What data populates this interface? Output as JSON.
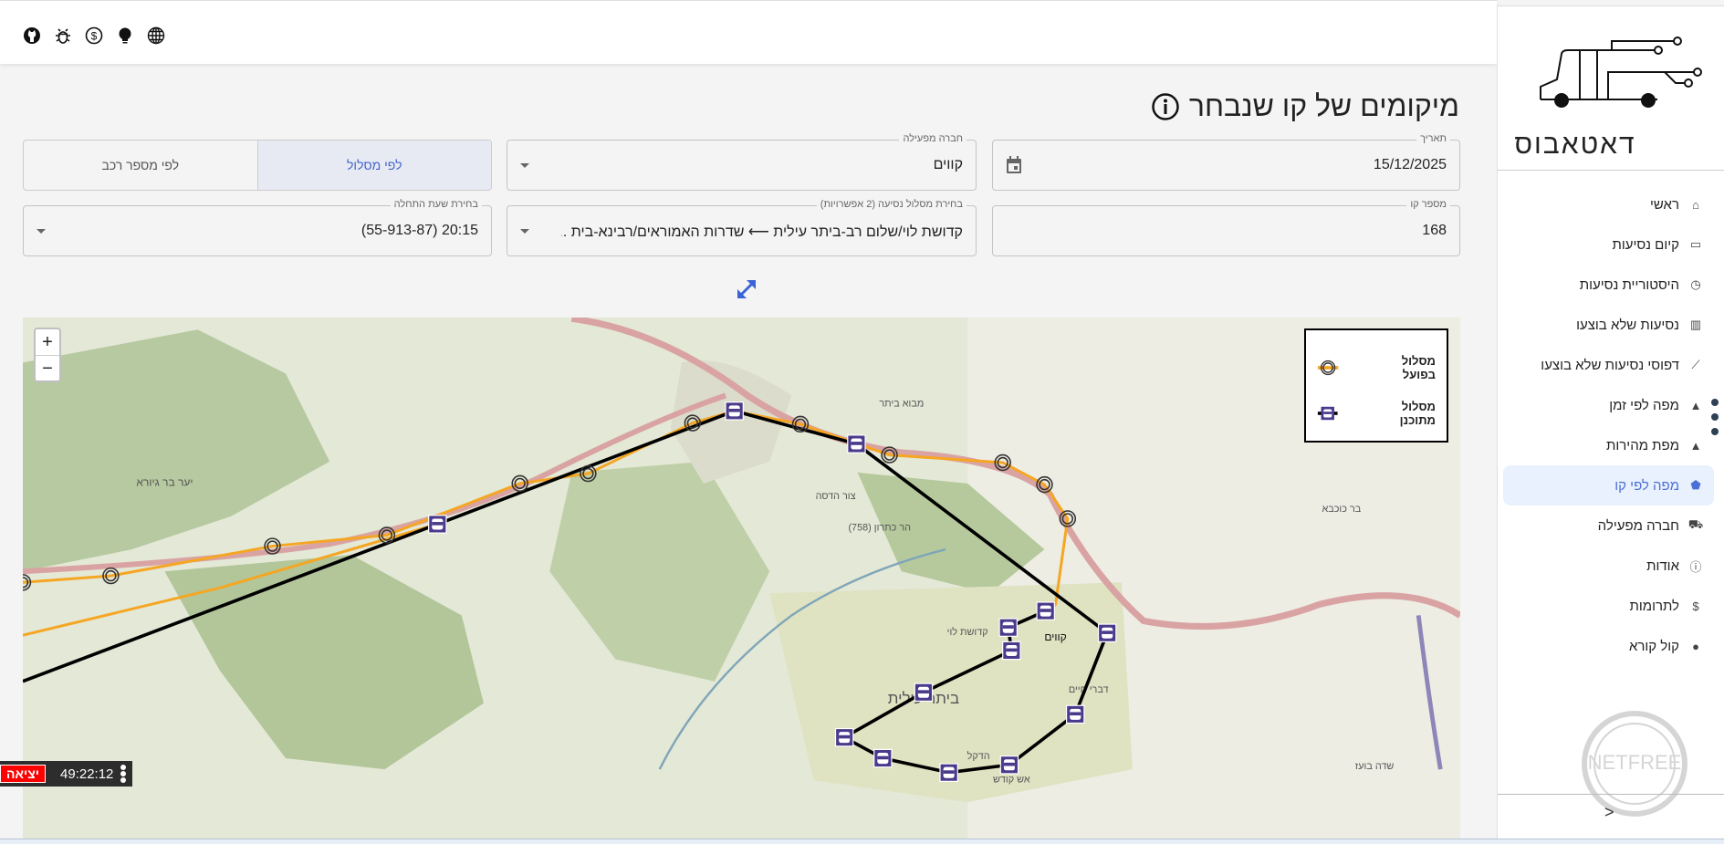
{
  "topbar": {
    "icons": [
      "github-icon",
      "bug-icon",
      "dollar-icon",
      "lightbulb-icon",
      "globe-icon"
    ]
  },
  "sidebar": {
    "logo_text": "דאטאבוס",
    "items": [
      {
        "label": "ראשי",
        "icon": "home-icon"
      },
      {
        "label": "קיום נסיעות",
        "icon": "laptop-icon"
      },
      {
        "label": "היסטוריית נסיעות",
        "icon": "history-icon"
      },
      {
        "label": "נסיעות שלא בוצעו",
        "icon": "bar-chart-icon"
      },
      {
        "label": "דפוסי נסיעות שלא בוצעו",
        "icon": "line-chart-icon"
      },
      {
        "label": "מפה לפי זמן",
        "icon": "heatmap-icon"
      },
      {
        "label": "מפת מהירות",
        "icon": "heatmap-icon"
      },
      {
        "label": "מפה לפי קו",
        "icon": "radar-icon",
        "selected": true
      },
      {
        "label": "חברה מפעילה",
        "icon": "truck-icon"
      },
      {
        "label": "אודות",
        "icon": "info-icon"
      },
      {
        "label": "לתרומות",
        "icon": "dollar-icon"
      },
      {
        "label": "קול קורא",
        "icon": "lightbulb-icon"
      }
    ],
    "collapse_glyph": ">",
    "watermark": "NETFREE מחשב מוגן"
  },
  "page": {
    "title": "מיקומים של קו שנבחר"
  },
  "filters": {
    "date": {
      "label": "תאריך",
      "value": "15/12/2025"
    },
    "operator": {
      "label": "חברה מפעילה",
      "value": "קווים"
    },
    "mode_toggle": {
      "options": [
        "לפי מסלול",
        "לפי מספר רכב"
      ],
      "selected": "לפי מסלול"
    },
    "line_number": {
      "label": "מספר קו",
      "value": "168"
    },
    "route": {
      "label": "בחירת מסלול נסיעה (2 אפשרויות)",
      "value": "קדושת לוי/שלום רב-ביתר עילית ⟵ שדרות האמוראים/רבינא-בית ..."
    },
    "start_time": {
      "label": "בחירת שעת התחלה",
      "value": "20:15 (55-913-87)"
    }
  },
  "map": {
    "zoom_in": "+",
    "zoom_out": "−",
    "legend": {
      "actual": "מסלול בפועל",
      "planned": "מסלול מתוכנן"
    },
    "colors": {
      "actual": "#f5a623",
      "planned": "#000000",
      "stop": "#4b3a8c",
      "road": "#d9a3a3"
    },
    "labels": [
      "ביתר עילית",
      "קווים",
      "צור הדסה",
      "הר כתרון (758)",
      "יער בר גיורא",
      "קדושת לוי",
      "אש קודש",
      "הדקל",
      "דברי חיים",
      "בר כוכבא",
      "שדה בועז",
      "מבוא ביתר"
    ]
  },
  "widget": {
    "exit": "יציאה",
    "time": "49:22:12"
  }
}
